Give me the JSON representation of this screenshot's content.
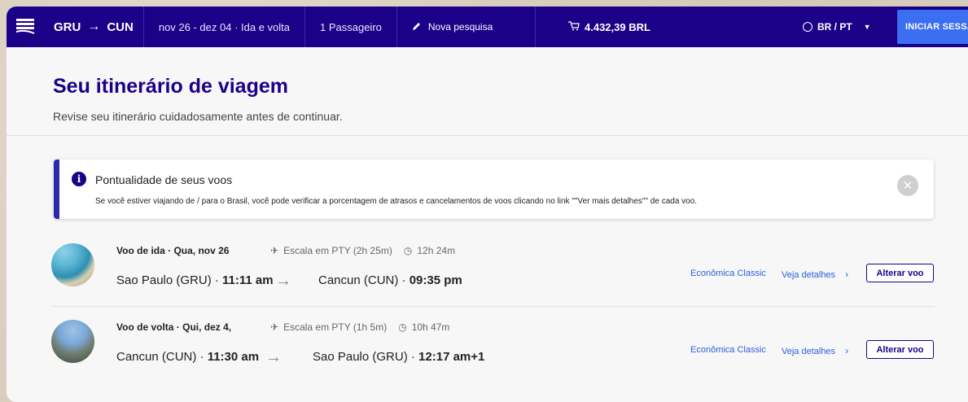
{
  "topbar": {
    "origin": "GRU",
    "destination": "CUN",
    "dates": "nov 26 - dez 04 · Ida e volta",
    "passengers": "1 Passageiro",
    "new_search": "Nova pesquisa",
    "cart_total": "4.432,39 BRL",
    "language": "BR / PT",
    "login": "INICIAR SESSÃO"
  },
  "page": {
    "title": "Seu itinerário de viagem",
    "subtitle": "Revise seu itinerário cuidadosamente antes de continuar."
  },
  "notice": {
    "title": "Pontualidade de seus voos",
    "text": "Se você estiver viajando de / para o Brasil, você pode verificar a porcentagem de atrasos e cancelamentos de voos clicando no link \"\"Ver mais detalhes\"\" de cada voo."
  },
  "flights": [
    {
      "header": "Voo de ida · Qua, nov 26",
      "stop": "Escala em PTY (2h 25m)",
      "duration": "12h 24m",
      "origin_city": "Sao Paulo (GRU) · ",
      "origin_time": "11:11 am",
      "dest_city": "Cancun (CUN) · ",
      "dest_time": "09:35 pm",
      "cabin": "Econômica Classic",
      "details": "Veja detalhes",
      "change": "Alterar voo"
    },
    {
      "header": "Voo de volta · Qui, dez 4,",
      "stop": "Escala em PTY (1h 5m)",
      "duration": "10h 47m",
      "origin_city": "Cancun (CUN) · ",
      "origin_time": "11:30 am",
      "dest_city": "Sao Paulo (GRU) · ",
      "dest_time": "12:17 am+1",
      "cabin": "Econômica Classic",
      "details": "Veja detalhes",
      "change": "Alterar voo"
    }
  ],
  "icons": {
    "logo": "airline-logo",
    "route_arrow": "→",
    "pencil": "pencil-icon",
    "cart": "cart-icon",
    "globe": "globe-icon",
    "info": "info-icon",
    "close": "close-icon",
    "plane": "plane-icon",
    "clock": "clock-icon",
    "long_arrow": "→",
    "chevron": "›"
  }
}
